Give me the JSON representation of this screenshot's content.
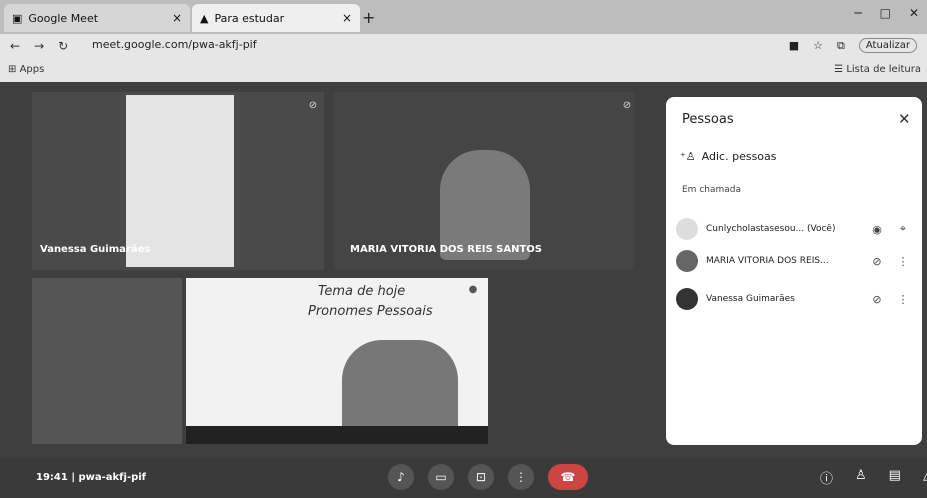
{
  "tabs": [
    {
      "title": "Google Meet",
      "close": "×"
    },
    {
      "title": "Para estudar",
      "close": "×"
    }
  ],
  "new_tab": "+",
  "window_controls": [
    "─",
    "□",
    "✕"
  ],
  "nav": {
    "back": "←",
    "forward": "→",
    "reload": "↻"
  },
  "address": {
    "url": "meet.google.com/pwa-akfj-pif",
    "update_label": "Atualizar"
  },
  "bookmarks": {
    "apps": "Apps",
    "reading_list": "Lista de leitura"
  },
  "participants": {
    "vanessa_tile_name": "Vanessa Guimarães",
    "maria_tile_name": "MARIA VITORIA DOS REIS SANTOS"
  },
  "presentation": {
    "line1": "Tema de hoje",
    "line2": "Pronomes Pessoais"
  },
  "people_panel": {
    "title": "Pessoas",
    "close": "✕",
    "add_people": "Adic. pessoas",
    "in_call_label": "Em chamada",
    "list": [
      {
        "name": "Cunlycholastasesou... (Você)"
      },
      {
        "name": "MARIA VITORIA DOS REIS..."
      },
      {
        "name": "Vanessa Guimarães"
      }
    ]
  },
  "bottom": {
    "time": "19:41",
    "meeting_code": "pwa-akfj-pif",
    "separator": "|"
  },
  "colors": {
    "end_call": "#cc4444",
    "panel_bg": "#ffffff",
    "meet_bg": "#3f3f3f"
  }
}
